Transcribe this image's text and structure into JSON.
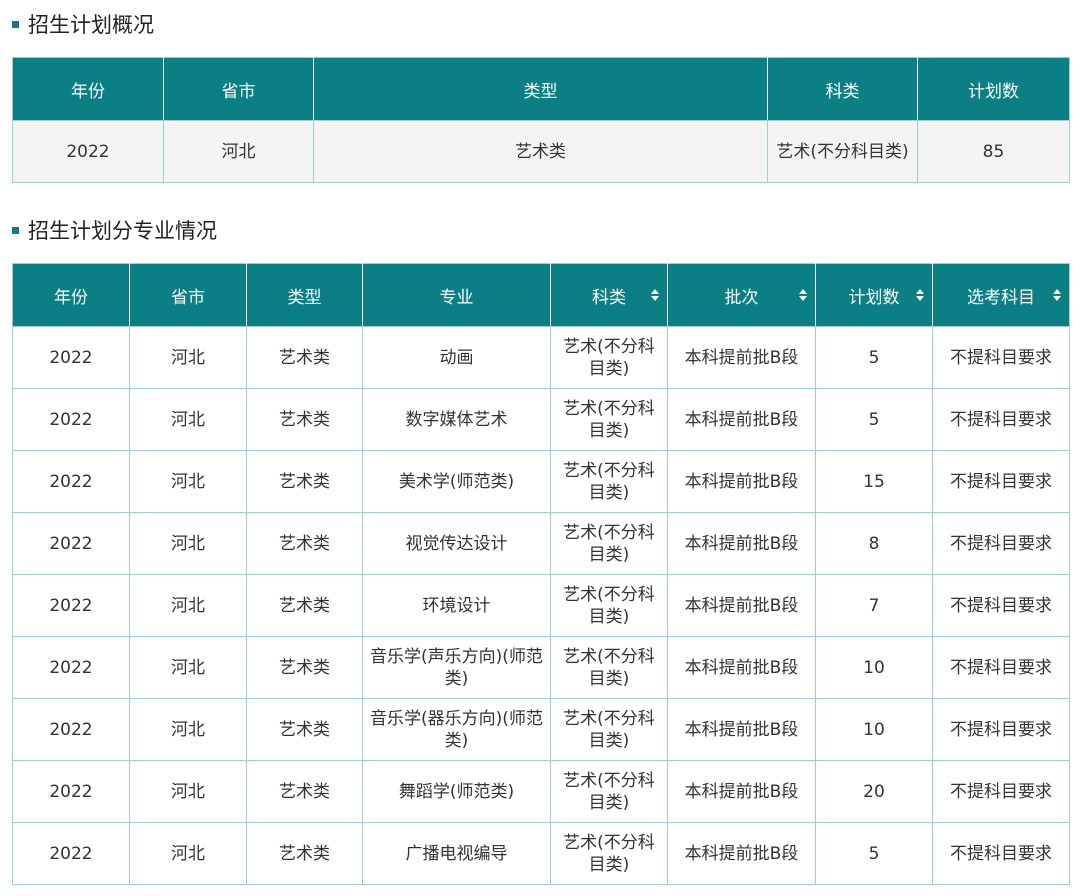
{
  "colors": {
    "header_bg": "#0b7f84",
    "accent": "#0b7f84"
  },
  "overview": {
    "title": "招生计划概况",
    "headers": [
      "年份",
      "省市",
      "类型",
      "科类",
      "计划数"
    ],
    "row": [
      "2022",
      "河北",
      "艺术类",
      "艺术(不分科目类)",
      "85"
    ]
  },
  "majors": {
    "title": "招生计划分专业情况",
    "headers": [
      "年份",
      "省市",
      "类型",
      "专业",
      "科类",
      "批次",
      "计划数",
      "选考科目"
    ],
    "sortable_icon": "sort-icon",
    "rows": [
      [
        "2022",
        "河北",
        "艺术类",
        "动画",
        "艺术(不分科目类)",
        "本科提前批B段",
        "5",
        "不提科目要求"
      ],
      [
        "2022",
        "河北",
        "艺术类",
        "数字媒体艺术",
        "艺术(不分科目类)",
        "本科提前批B段",
        "5",
        "不提科目要求"
      ],
      [
        "2022",
        "河北",
        "艺术类",
        "美术学(师范类)",
        "艺术(不分科目类)",
        "本科提前批B段",
        "15",
        "不提科目要求"
      ],
      [
        "2022",
        "河北",
        "艺术类",
        "视觉传达设计",
        "艺术(不分科目类)",
        "本科提前批B段",
        "8",
        "不提科目要求"
      ],
      [
        "2022",
        "河北",
        "艺术类",
        "环境设计",
        "艺术(不分科目类)",
        "本科提前批B段",
        "7",
        "不提科目要求"
      ],
      [
        "2022",
        "河北",
        "艺术类",
        "音乐学(声乐方向)(师范类)",
        "艺术(不分科目类)",
        "本科提前批B段",
        "10",
        "不提科目要求"
      ],
      [
        "2022",
        "河北",
        "艺术类",
        "音乐学(器乐方向)(师范类)",
        "艺术(不分科目类)",
        "本科提前批B段",
        "10",
        "不提科目要求"
      ],
      [
        "2022",
        "河北",
        "艺术类",
        "舞蹈学(师范类)",
        "艺术(不分科目类)",
        "本科提前批B段",
        "20",
        "不提科目要求"
      ],
      [
        "2022",
        "河北",
        "艺术类",
        "广播电视编导",
        "艺术(不分科目类)",
        "本科提前批B段",
        "5",
        "不提科目要求"
      ]
    ]
  }
}
